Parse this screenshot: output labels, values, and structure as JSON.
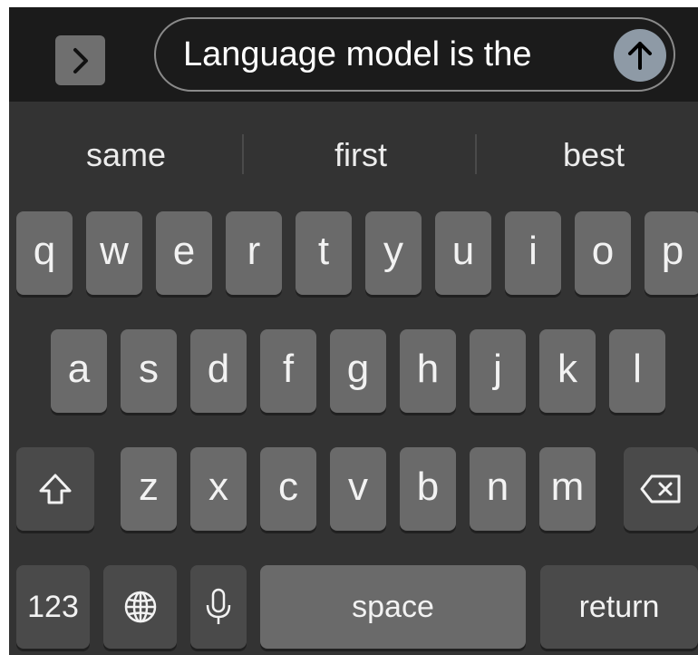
{
  "input": {
    "text": "Language model is the"
  },
  "suggestions": [
    "same",
    "first",
    "best"
  ],
  "keyboard": {
    "row1": [
      "q",
      "w",
      "e",
      "r",
      "t",
      "y",
      "u",
      "i",
      "o",
      "p"
    ],
    "row2": [
      "a",
      "s",
      "d",
      "f",
      "g",
      "h",
      "j",
      "k",
      "l"
    ],
    "row3": [
      "z",
      "x",
      "c",
      "v",
      "b",
      "n",
      "m"
    ],
    "numbers_label": "123",
    "space_label": "space",
    "return_label": "return"
  },
  "icons": {
    "expand": "chevron-right-icon",
    "send": "arrow-up-icon",
    "shift": "shift-icon",
    "delete": "backspace-icon",
    "globe": "globe-icon",
    "mic": "microphone-icon"
  },
  "colors": {
    "keyboard_bg": "#333333",
    "key": "#6a6a6a",
    "key_dark": "#4a4a4a",
    "topbar_bg": "#1b1b1b",
    "send_button": "#8e9aa6"
  }
}
